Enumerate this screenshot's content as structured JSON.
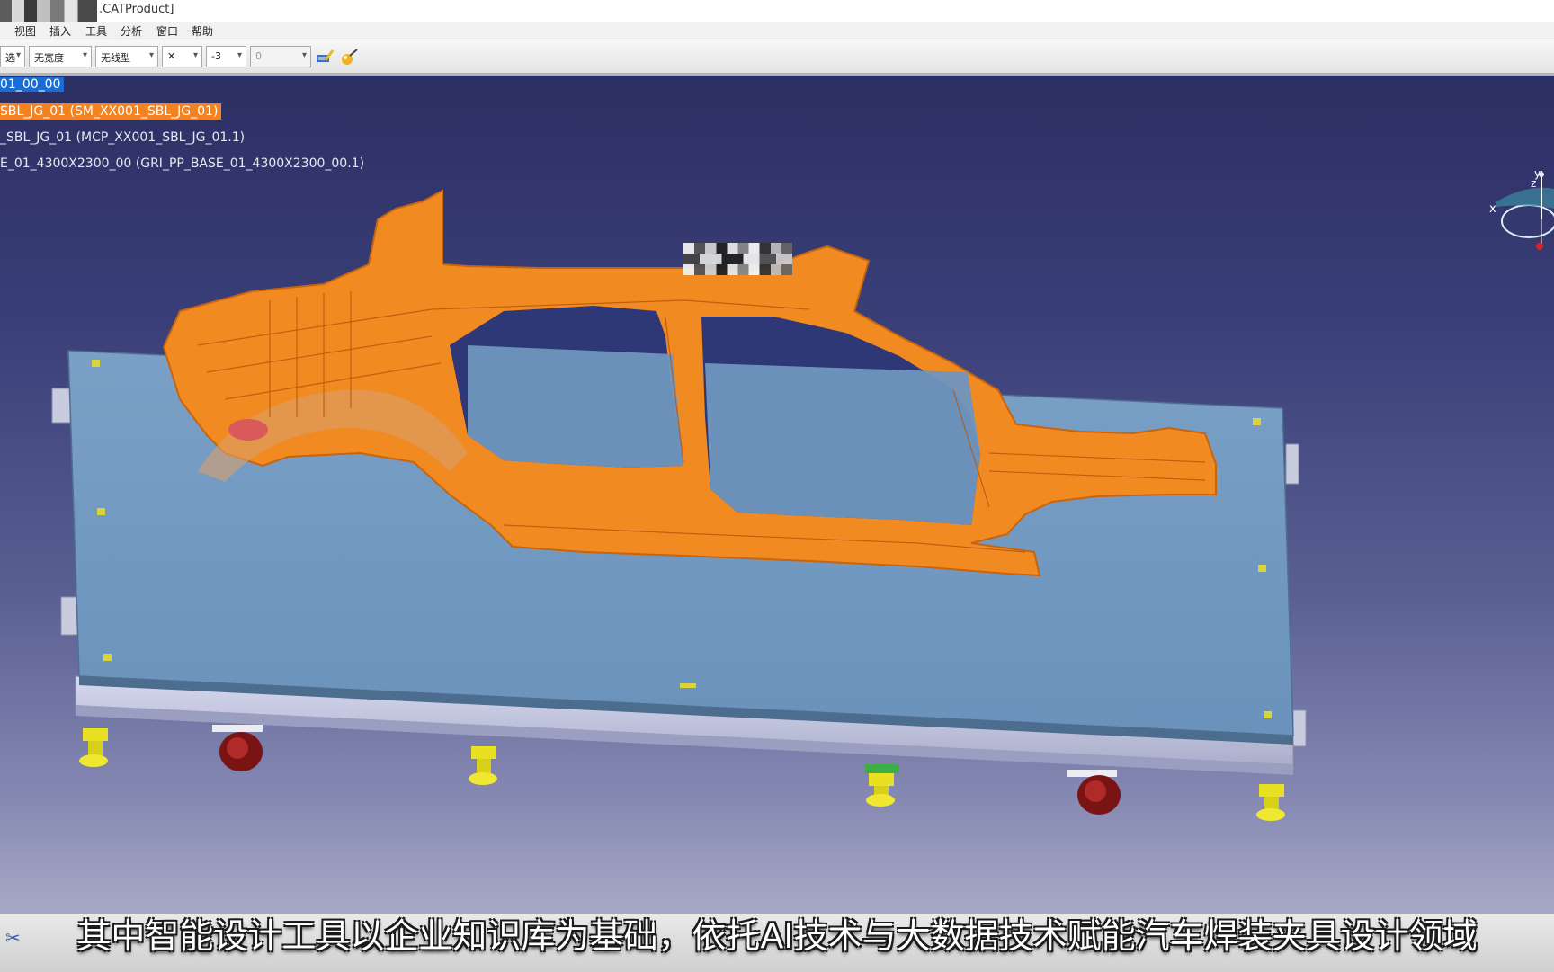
{
  "window": {
    "title": ".CATProduct]"
  },
  "menu": {
    "items": [
      "视图",
      "插入",
      "工具",
      "分析",
      "窗口",
      "帮助"
    ]
  },
  "toolbar": {
    "combo_1": "选",
    "combo_2": "无宽度",
    "combo_3": "无线型",
    "combo_4": "✕",
    "combo_5": "-3",
    "combo_6": "0"
  },
  "tree": {
    "root": "01_00_00",
    "selected": "SBL_JG_01 (SM_XX001_SBL_JG_01)",
    "node_3": "_SBL_JG_01 (MCP_XX001_SBL_JG_01.1)",
    "node_4": "E_01_4300X2300_00 (GRI_PP_BASE_01_4300X2300_00.1)"
  },
  "compass": {
    "x_label": "x",
    "y_label": "y",
    "z_label": "z"
  },
  "subtitle": "其中智能设计工具以企业知识库为基础，依托AI技术与大数据技术赋能汽车焊装夹具设计领域",
  "colors": {
    "selection_orange": "#f58220",
    "part_orange": "#f28a22",
    "base_plate": "#6f96bf",
    "background_top": "#2c2f63"
  }
}
